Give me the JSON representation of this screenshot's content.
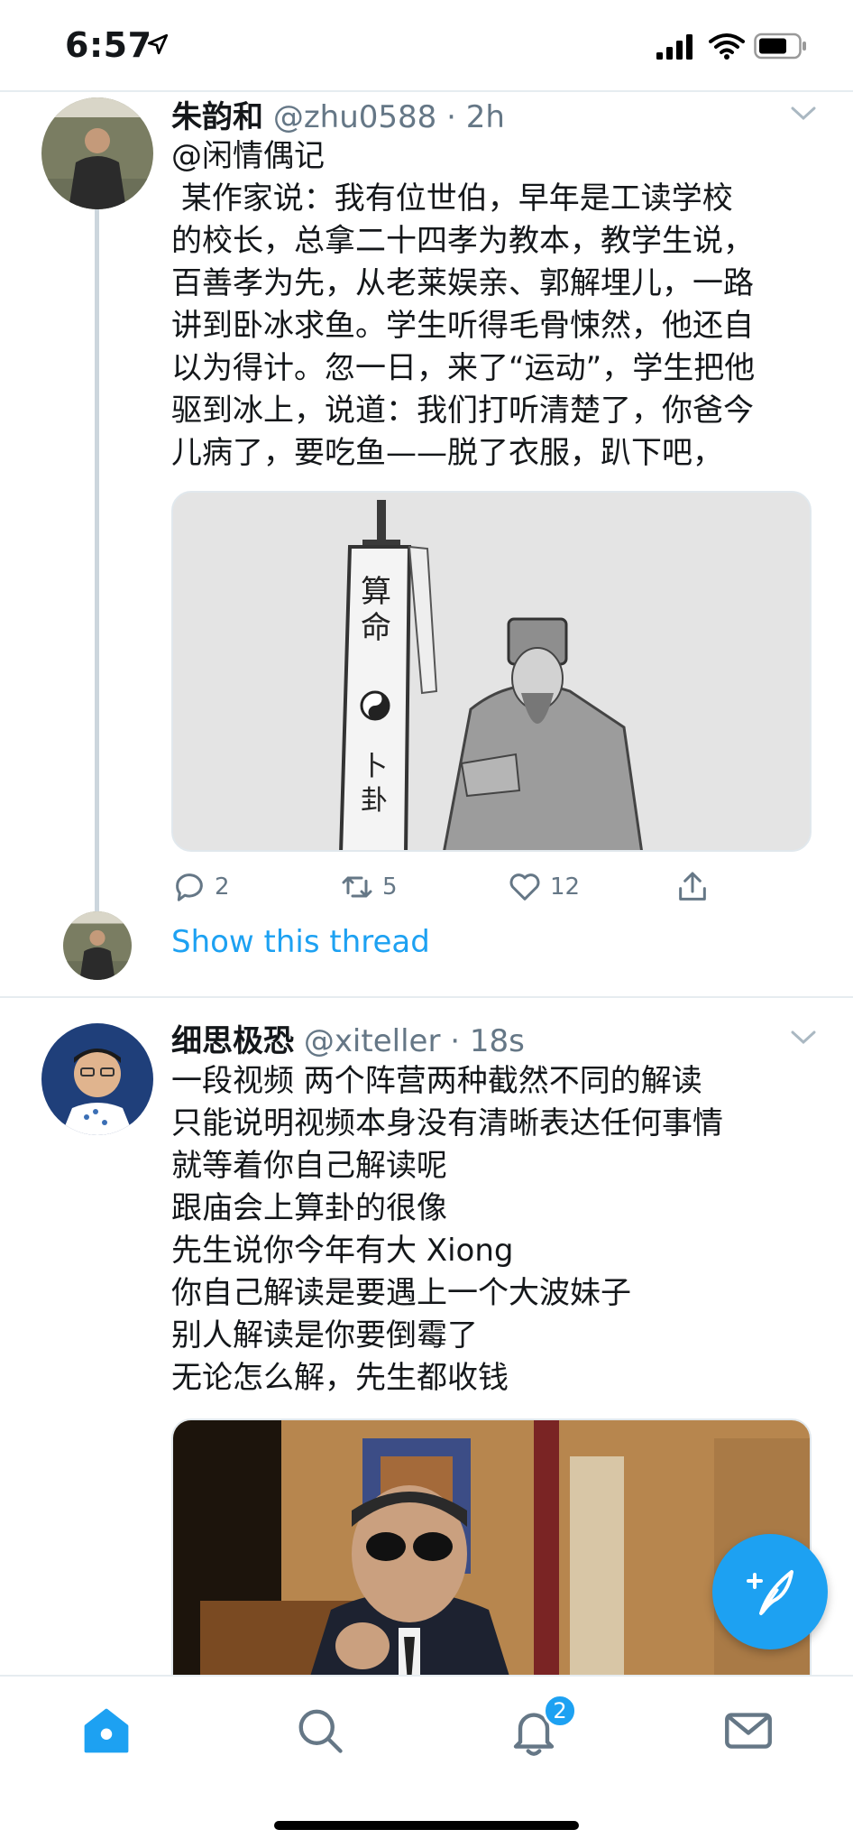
{
  "status_bar": {
    "time": "6:57"
  },
  "tweets": [
    {
      "author_name": "朱韵和",
      "handle": "@zhu0588",
      "time": "2h",
      "reply_to": "@闲情偶记",
      "body": " 某作家说：我有位世伯，早年是工读学校\n的校长，总拿二十四孝为教本，教学生说，\n百善孝为先，从老莱娱亲、郭解埋儿，一路\n讲到卧冰求鱼。学生听得毛骨悚然，他还自\n以为得计。忽一日，来了“运动”，学生把他\n驱到冰上，说道：我们打听清楚了，你爸今\n儿病了，要吃鱼——脱了衣服，趴下吧，",
      "media_text": {
        "banner_top": "算命",
        "banner_bottom": "卜卦"
      },
      "replies": "2",
      "retweets": "5",
      "likes": "12",
      "show_thread": "Show this thread"
    },
    {
      "author_name": "细思极恐",
      "handle": "@xiteller",
      "time": "18s",
      "body": "一段视频 两个阵营两种截然不同的解读\n只能说明视频本身没有清晰表达任何事情\n就等着你自己解读呢\n跟庙会上算卦的很像\n先生说你今年有大 Xiong\n你自己解读是要遇上一个大波妹子\n别人解读是你要倒霉了\n无论怎么解，先生都收钱"
    }
  ],
  "tab_bar": {
    "items": [
      "home-icon",
      "search-icon",
      "notifications-icon",
      "messages-icon"
    ],
    "notifications_badge": "2"
  },
  "colors": {
    "accent": "#1da1f2",
    "meta": "#657786",
    "divider": "#e6ecf0"
  }
}
